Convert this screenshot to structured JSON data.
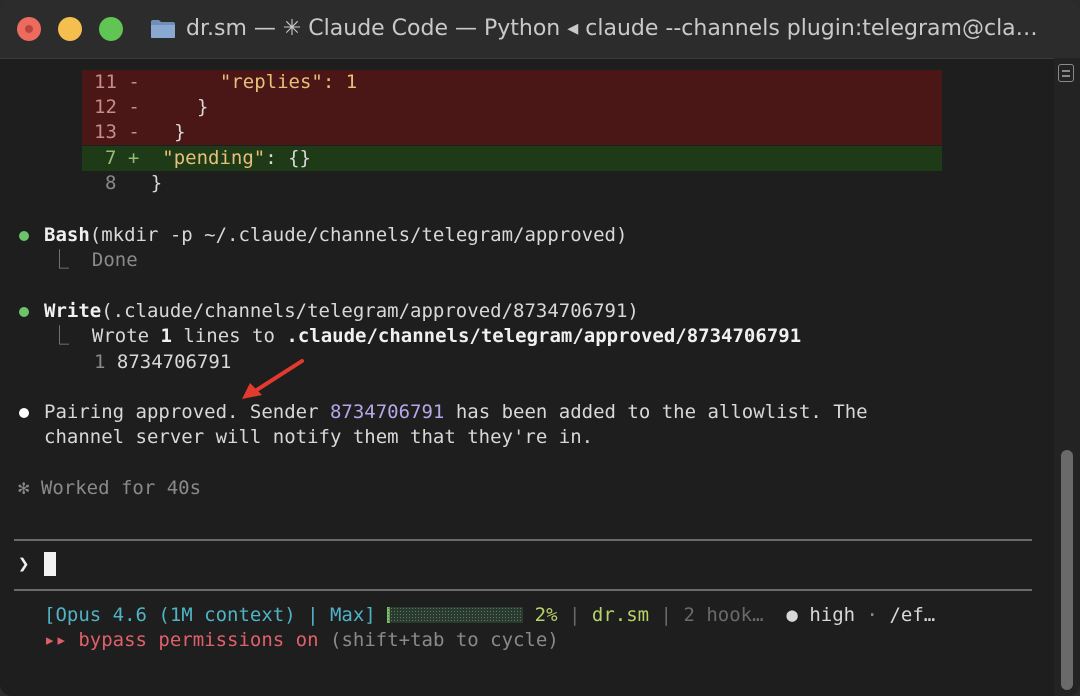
{
  "window": {
    "title": "dr.sm — ✳ Claude Code — Python ◂ claude --channels plugin:telegram@cla…"
  },
  "diff": {
    "lines": [
      {
        "num": "11",
        "sign": "-",
        "code": "    \"replies\": 1"
      },
      {
        "num": "12",
        "sign": "-",
        "code": "  }"
      },
      {
        "num": "13",
        "sign": "-",
        "code": "}"
      },
      {
        "num": "7",
        "sign": "+",
        "code_key": "\"pending\"",
        "code_rest": ": {}"
      },
      {
        "num": "8",
        "sign": "",
        "code": "}"
      }
    ]
  },
  "bash_step": {
    "tool": "Bash",
    "args": "(mkdir -p ~/.claude/channels/telegram/approved)",
    "result": "Done"
  },
  "write_step": {
    "tool": "Write",
    "args": "(.claude/channels/telegram/approved/8734706791)",
    "result_prefix": "Wrote ",
    "result_count": "1",
    "result_mid": " lines to ",
    "result_path": ".claude/channels/telegram/approved/8734706791",
    "file_line_num": "1",
    "file_line_text": "8734706791"
  },
  "message": {
    "part1": "Pairing approved. Sender ",
    "sender_id": "8734706791",
    "part2": " has been added to the allowlist. The",
    "line2": "channel server will notify them that they're in."
  },
  "worked": {
    "glyph": "✻",
    "text": "Worked for 40s"
  },
  "prompt": {
    "glyph": "❯",
    "value": ""
  },
  "status": {
    "model": "[Opus 4.6 (1M context) | Max]",
    "context_percent": "2%",
    "context_fill": 0.02,
    "sep": "|",
    "project": "dr.sm",
    "hooks": "2 hook…",
    "effort_dot": "●",
    "effort": "high",
    "middot": "·",
    "effort_cmd": "/ef…",
    "mode_glyph": "▸▸",
    "mode_text": "bypass permissions on",
    "mode_hint": " (shift+tab to cycle)"
  },
  "colors": {
    "diff_removed_bg": "#4a1616",
    "diff_added_bg": "#1f3a17",
    "success_bullet": "#6cc36a",
    "accent_id": "#b7a6e8",
    "status_teal": "#4fb3c6",
    "bypass_red": "#e0606a"
  }
}
